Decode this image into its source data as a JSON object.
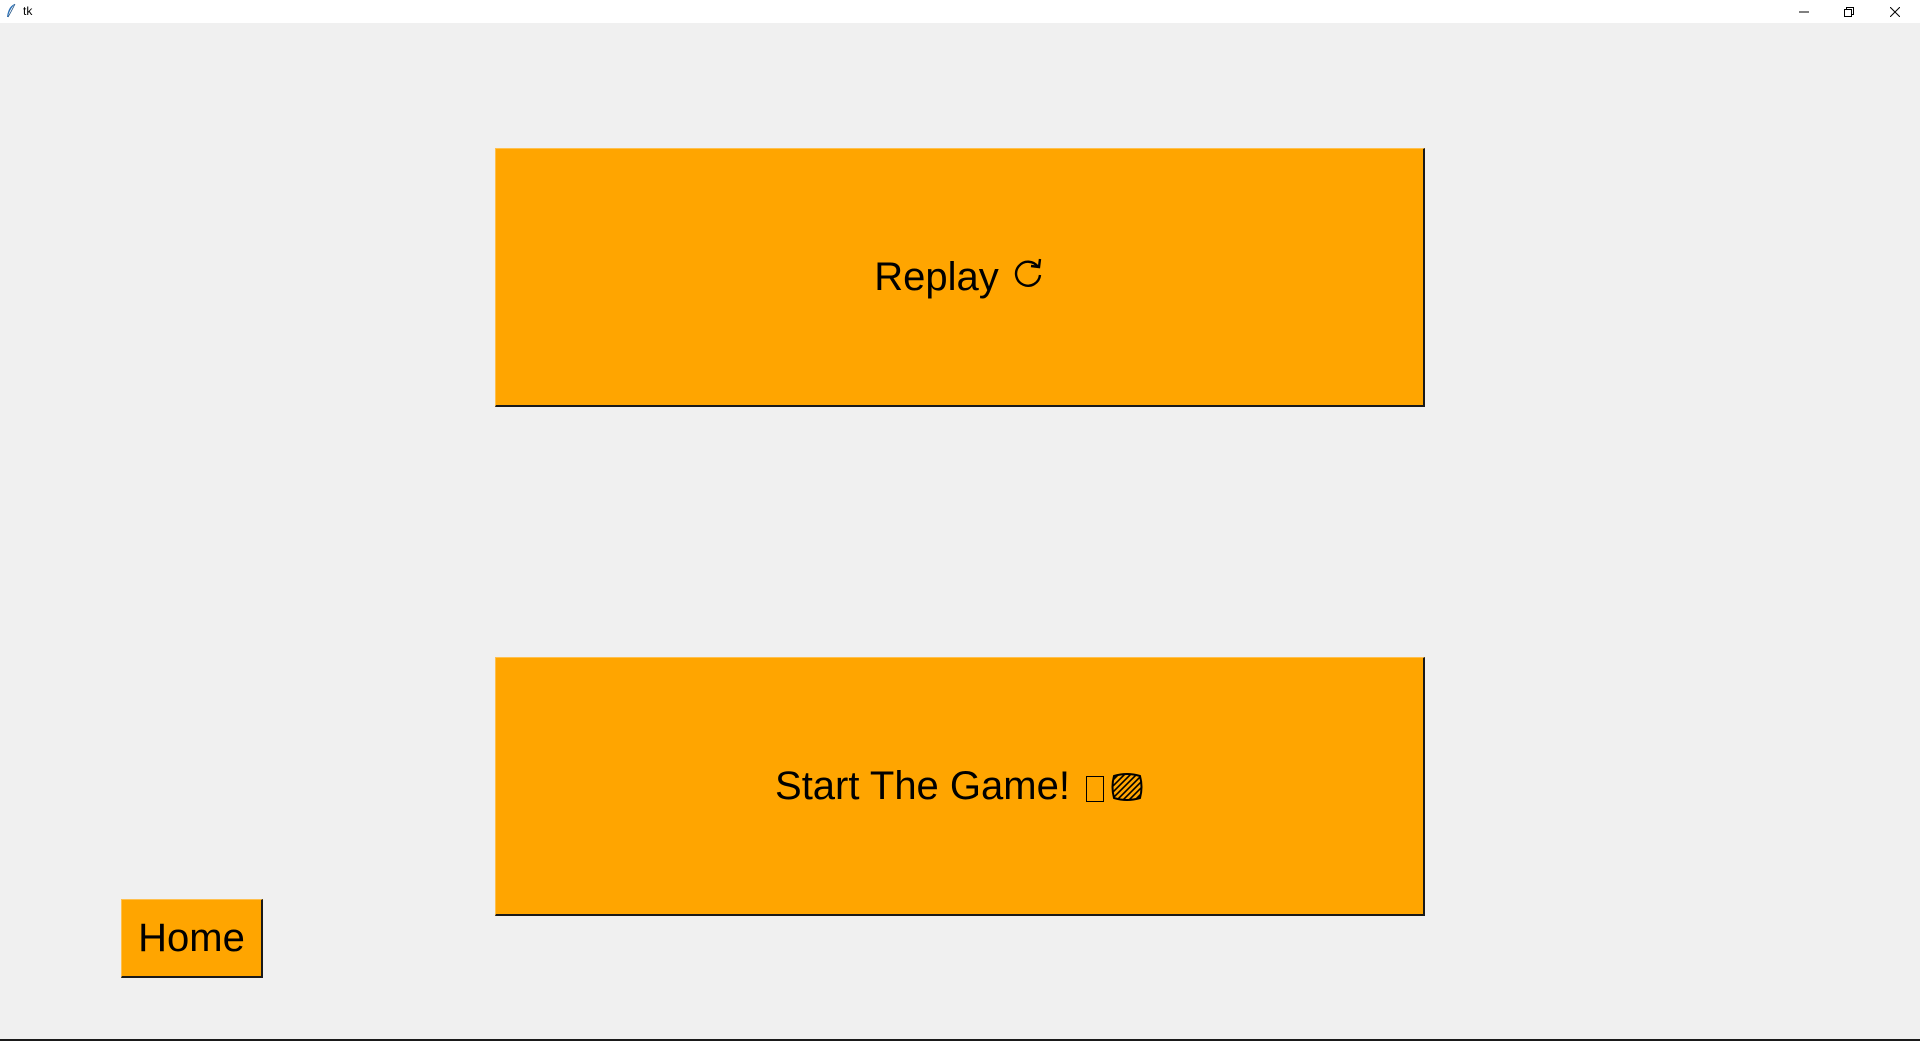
{
  "window": {
    "title": "tk",
    "controls": [
      "minimize-icon",
      "restore-icon",
      "close-icon"
    ]
  },
  "buttons": {
    "replay_label": "Replay",
    "replay_icon": "replay-icon",
    "start_label": "Start The Game!",
    "start_icons": [
      "missing-glyph-icon",
      "hatched-glyph-icon"
    ],
    "home_label": "Home"
  },
  "colors": {
    "button_bg": "#ffa500",
    "window_bg": "#f0f0f0",
    "titlebar_bg": "#ffffff",
    "text": "#000000"
  }
}
